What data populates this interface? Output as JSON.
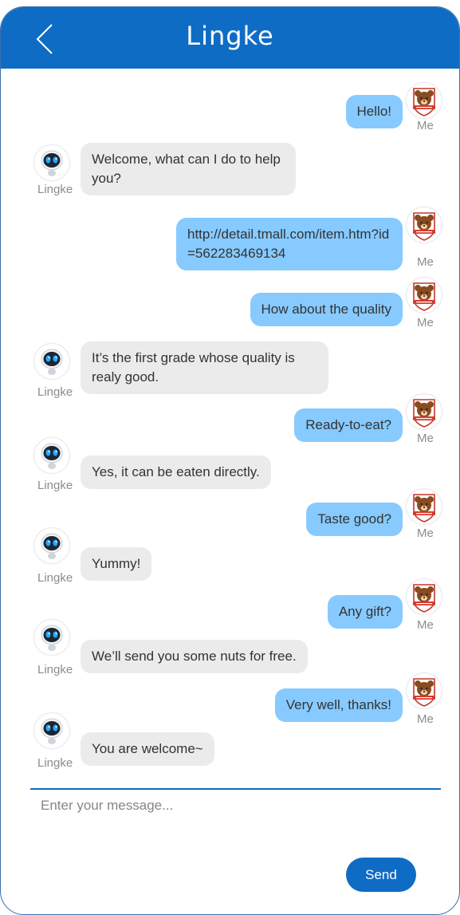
{
  "header": {
    "title": "Lingke",
    "back_icon": "chevron-left-icon"
  },
  "colors": {
    "brand": "#0f6cc5",
    "my_bubble": "#87caff",
    "bot_bubble": "#ebebeb"
  },
  "users": {
    "me": "Me",
    "bot": "Lingke"
  },
  "messages": [
    {
      "from": "me",
      "text": "Hello!"
    },
    {
      "from": "bot",
      "text": "Welcome, what can I do to help you?"
    },
    {
      "from": "me",
      "text": "http://detail.tmall.com/item.htm?id=562283469134"
    },
    {
      "from": "me",
      "text": "How about the quality"
    },
    {
      "from": "bot",
      "text": "It’s the first grade whose quality is realy good."
    },
    {
      "from": "me",
      "text": "Ready-to-eat?"
    },
    {
      "from": "bot",
      "text": "Yes, it can be eaten directly."
    },
    {
      "from": "me",
      "text": "Taste good?"
    },
    {
      "from": "bot",
      "text": "Yummy!"
    },
    {
      "from": "me",
      "text": "Any gift?"
    },
    {
      "from": "bot",
      "text": "We’ll send you some nuts for free."
    },
    {
      "from": "me",
      "text": "Very well, thanks!"
    },
    {
      "from": "bot",
      "text": "You are welcome~"
    }
  ],
  "composer": {
    "placeholder": "Enter your message...",
    "send_label": "Send"
  }
}
